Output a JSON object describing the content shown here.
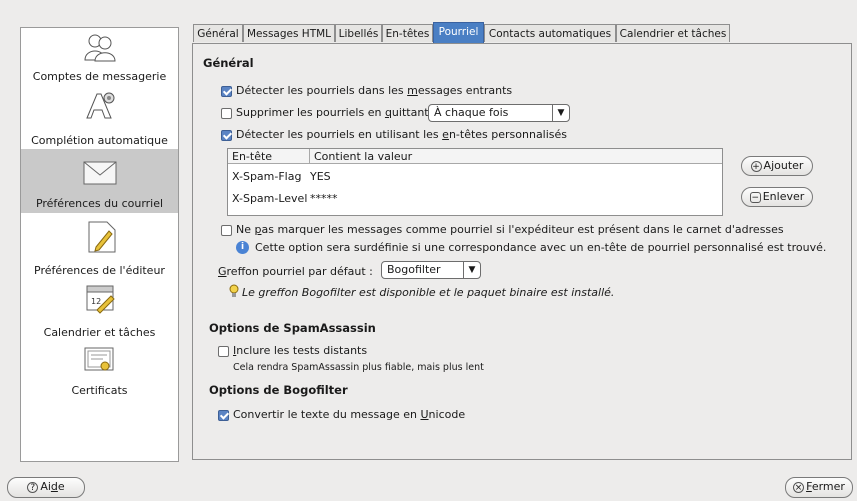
{
  "sidebar": {
    "items": [
      {
        "label": "Comptes de messagerie",
        "icon": "accounts-icon"
      },
      {
        "label": "Complétion automatique",
        "icon": "autocompletion-icon"
      },
      {
        "label": "Préférences du courriel",
        "icon": "mail-envelope-icon"
      },
      {
        "label": "Préférences de l'éditeur",
        "icon": "editor-pencil-icon"
      },
      {
        "label": "Calendrier et tâches",
        "icon": "calendar-icon"
      },
      {
        "label": "Certificats",
        "icon": "certificate-icon"
      }
    ],
    "selected_index": 2
  },
  "tabs": [
    "Général",
    "Messages HTML",
    "Libellés",
    "En-têtes",
    "Pourriel",
    "Contacts automatiques",
    "Calendrier et tâches"
  ],
  "active_tab": "Pourriel",
  "general": {
    "heading": "Général",
    "detect_incoming": {
      "label_pre": "Détecter les pourriels dans les ",
      "label_u": "m",
      "label_post": "essages entrants",
      "checked": true
    },
    "delete_on_quit": {
      "label_pre": "Supprimer les pourriels en ",
      "label_u": "q",
      "label_post": "uittant",
      "checked": false
    },
    "delete_frequency": "À chaque fois",
    "detect_headers": {
      "label_pre": "Détecter les pourriels en utilisant les ",
      "label_u": "e",
      "label_post": "n-têtes personnalisés",
      "checked": true
    },
    "header_table": {
      "columns": [
        "En-tête",
        "Contient la valeur"
      ],
      "rows": [
        {
          "header": "X-Spam-Flag",
          "value": "YES"
        },
        {
          "header": "X-Spam-Level",
          "value": "*****"
        }
      ]
    },
    "add_button": "Ajouter",
    "remove_button": "Enlever",
    "not_spam_if_contact": {
      "label_pre": "Ne ",
      "label_u": "p",
      "label_post": "as marquer les messages comme pourriel si l'expéditeur est présent dans le carnet d'adresses",
      "checked": false
    },
    "info_note": "Cette option sera surdéfinie si une correspondance avec un en-tête de pourriel personnalisé est trouvé.",
    "default_plugin_label_u": "G",
    "default_plugin_label_post": "reffon pourriel par défaut :",
    "default_plugin_value": "Bogofilter",
    "plugin_status": "Le greffon Bogofilter est disponible et le paquet binaire est installé."
  },
  "spamassassin": {
    "heading": "Options de SpamAssassin",
    "remote_tests": {
      "label_u": "I",
      "label_post": "nclure les tests distants",
      "checked": false
    },
    "remote_tests_hint": "Cela rendra SpamAssassin plus fiable, mais plus lent"
  },
  "bogofilter": {
    "heading": "Options de Bogofilter",
    "unicode": {
      "label_pre": "Convertir le texte du message en ",
      "label_u": "U",
      "label_post": "nicode",
      "checked": true
    }
  },
  "footer": {
    "help_pre": "Ai",
    "help_u": "d",
    "help_post": "e",
    "close_u": "F",
    "close_post": "ermer"
  }
}
